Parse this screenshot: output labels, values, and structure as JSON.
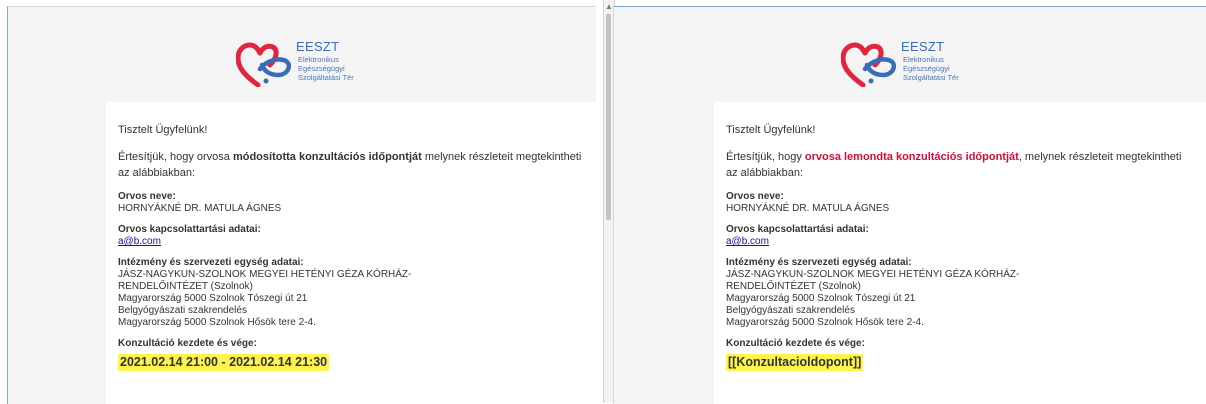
{
  "left": {
    "logo": {
      "brand": "EESZT",
      "lines": [
        "Elektronikus",
        "Egészségügyi",
        "Szolgáltatási Tér"
      ]
    },
    "greeting": "Tisztelt Ügyfelünk!",
    "intro_before": "Értesítjük, hogy orvosa ",
    "intro_bold": "módosította konzultációs időpontját",
    "intro_after": " melynek részleteit megtekintheti az alábbiakban:",
    "doctor_label": "Orvos neve:",
    "doctor_value": "HORNYÁKNÉ DR. MATULA ÁGNES",
    "contact_label": "Orvos kapcsolattartási adatai:",
    "contact_value": "a@b.com",
    "inst_label": "Intézmény és szervezeti egység adatai:",
    "inst_lines": [
      "JÁSZ-NAGYKUN-SZOLNOK MEGYEI HETÉNYI GÉZA KÓRHÁZ-",
      "RENDELŐINTÉZET (Szolnok)",
      "Magyarország 5000 Szolnok Tószegi út 21",
      "Belgyógyászati szakrendelés",
      "Magyarország 5000 Szolnok Hősök tere 2-4."
    ],
    "appt_label": "Konzultáció kezdete és vége:",
    "appt_value": "2021.02.14 21:00 - 2021.02.14 21:30"
  },
  "right": {
    "logo": {
      "brand": "EESZT",
      "lines": [
        "Elektronikus",
        "Egészségügyi",
        "Szolgáltatási Tér"
      ]
    },
    "greeting": "Tisztelt Ügyfelünk!",
    "intro_before": "Értesítjük, hogy ",
    "intro_bold": "orvosa lemondta konzultációs időpontját",
    "intro_after": ", melynek részleteit megtekintheti az alábbiakban:",
    "doctor_label": "Orvos neve:",
    "doctor_value": "HORNYÁKNÉ DR. MATULA ÁGNES",
    "contact_label": "Orvos kapcsolattartási adatai:",
    "contact_value": "a@b.com",
    "inst_label": "Intézmény és szervezeti egység adatai:",
    "inst_lines": [
      "JÁSZ-NAGYKUN-SZOLNOK MEGYEI HETÉNYI GÉZA KÓRHÁZ-",
      "RENDELŐINTÉZET (Szolnok)",
      "Magyarország 5000 Szolnok Tószegi út 21",
      "Belgyógyászati szakrendelés",
      "Magyarország 5000 Szolnok Hősök tere 2-4."
    ],
    "appt_label": "Konzultáció kezdete és vége:",
    "appt_value": "[[Konzultacioldopont]]"
  },
  "colors": {
    "highlight": "#fff34d",
    "cancel_red": "#d0103a",
    "link": "#1a0dab",
    "brand_blue": "#3a6db5"
  }
}
